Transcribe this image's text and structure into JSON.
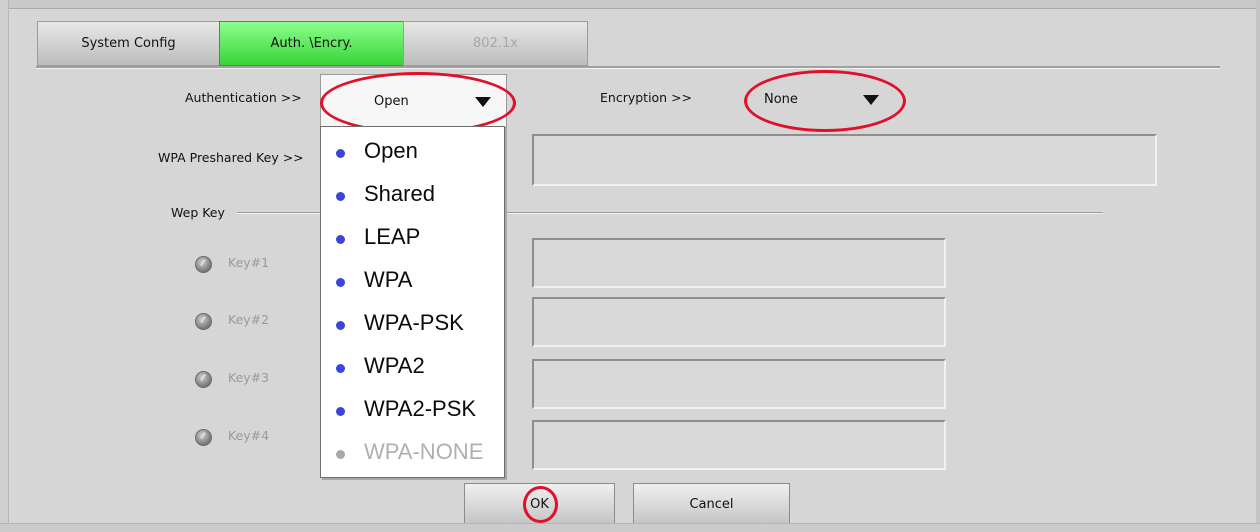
{
  "tabs": [
    {
      "label": "System Config",
      "state": "normal"
    },
    {
      "label": "Auth. \\Encry.",
      "state": "active"
    },
    {
      "label": "802.1x",
      "state": "disabled"
    }
  ],
  "authentication": {
    "label": "Authentication >>",
    "selected": "Open"
  },
  "encryption": {
    "label": "Encryption >>",
    "selected": "None"
  },
  "wpa_psk": {
    "label": "WPA Preshared Key >>",
    "value": ""
  },
  "wep": {
    "group_label": "Wep Key",
    "keys": [
      {
        "label": "Key#1",
        "value": ""
      },
      {
        "label": "Key#2",
        "value": ""
      },
      {
        "label": "Key#3",
        "value": ""
      },
      {
        "label": "Key#4",
        "value": ""
      }
    ]
  },
  "auth_options": [
    {
      "label": "Open",
      "enabled": true
    },
    {
      "label": "Shared",
      "enabled": true
    },
    {
      "label": "LEAP",
      "enabled": true
    },
    {
      "label": "WPA",
      "enabled": true
    },
    {
      "label": "WPA-PSK",
      "enabled": true
    },
    {
      "label": "WPA2",
      "enabled": true
    },
    {
      "label": "WPA2-PSK",
      "enabled": true
    },
    {
      "label": "WPA-NONE",
      "enabled": false
    }
  ],
  "buttons": {
    "ok": "OK",
    "cancel": "Cancel"
  },
  "colors": {
    "active_tab": "#39d339",
    "highlight_ring": "#e0102a",
    "option_bullet": "#3b46d8"
  }
}
